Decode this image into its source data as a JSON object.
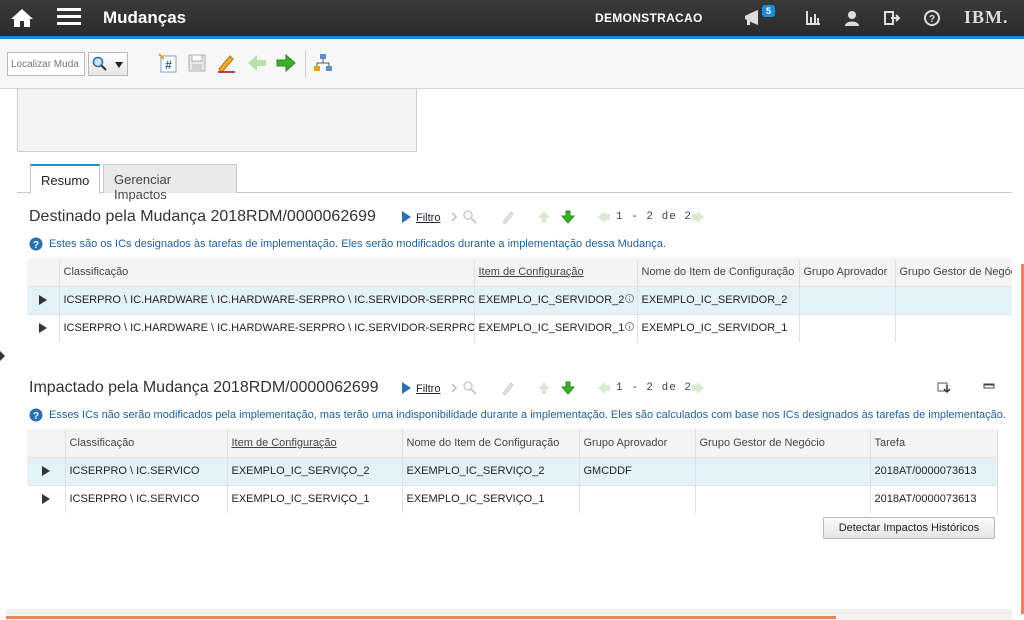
{
  "header": {
    "app_title": "Mudanças",
    "user": "DEMONSTRACAO",
    "notification_count": "5",
    "brand": "IBM.",
    "accent_color": "#1f8dd6"
  },
  "toolbar": {
    "search_placeholder": "Localizar Muda"
  },
  "tabs": [
    {
      "label": "Resumo",
      "active": true
    },
    {
      "label": "Gerenciar Impactos",
      "active": false
    }
  ],
  "section1": {
    "title": "Destinado pela Mudança 2018RDM/0000062699",
    "filter_label": "Filtro",
    "pager": "1 - 2 de 2",
    "info": "Estes são os ICs designados às tarefas de implementação. Eles serão modificados durante a implementação dessa Mudança.",
    "columns": [
      "Classificação",
      "Item de Configuração",
      "Nome do Item de Configuração",
      "Grupo Aprovador",
      "Grupo Gestor de Negócio"
    ],
    "rows": [
      {
        "classificacao": "ICSERPRO \\ IC.HARDWARE \\ IC.HARDWARE-SERPRO \\ IC.SERVIDOR-SERPRO",
        "item": "EXEMPLO_IC_SERVIDOR_2",
        "nome": "EXEMPLO_IC_SERVIDOR_2",
        "aprovador": "",
        "gestor": "",
        "selected": true
      },
      {
        "classificacao": "ICSERPRO \\ IC.HARDWARE \\ IC.HARDWARE-SERPRO \\ IC.SERVIDOR-SERPRO",
        "item": "EXEMPLO_IC_SERVIDOR_1",
        "nome": "EXEMPLO_IC_SERVIDOR_1",
        "aprovador": "",
        "gestor": "",
        "selected": false
      }
    ]
  },
  "section2": {
    "title": "Impactado pela Mudança 2018RDM/0000062699",
    "filter_label": "Filtro",
    "pager": "1 - 2 de 2",
    "info": "Esses ICs não serão modificados pela implementação, mas terão uma indisponibilidade durante a implementação. Eles são calculados com base nos ICs designados às tarefas de implementação.",
    "columns": [
      "Classificação",
      "Item de Configuração",
      "Nome do Item de Configuração",
      "Grupo Aprovador",
      "Grupo Gestor de Negócio",
      "Tarefa"
    ],
    "rows": [
      {
        "classificacao": "ICSERPRO \\ IC.SERVICO",
        "item": "EXEMPLO_IC_SERVIÇO_2",
        "nome": "EXEMPLO_IC_SERVIÇO_2",
        "aprovador": "GMCDDF",
        "gestor": "",
        "tarefa": "2018AT/0000073613",
        "selected": true
      },
      {
        "classificacao": "ICSERPRO \\ IC.SERVICO",
        "item": "EXEMPLO_IC_SERVIÇO_1",
        "nome": "EXEMPLO_IC_SERVIÇO_1",
        "aprovador": "",
        "gestor": "",
        "tarefa": "2018AT/0000073613",
        "selected": false
      }
    ],
    "button_label": "Detectar Impactos Históricos"
  }
}
